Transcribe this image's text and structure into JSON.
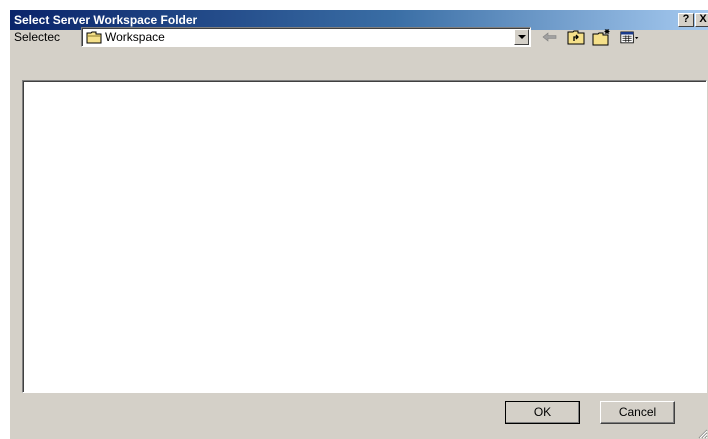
{
  "window": {
    "title": "Select Server Workspace Folder",
    "help_label": "?",
    "close_label": "X"
  },
  "location": {
    "label": "Selectec",
    "value": "Workspace",
    "icon": "folder-icon"
  },
  "toolbar": {
    "icons": [
      "back-arrow-icon",
      "up-folder-icon",
      "new-folder-icon",
      "view-menu-icon"
    ]
  },
  "buttons": {
    "ok_label": "OK",
    "cancel_label": "Cancel"
  },
  "colors": {
    "title_start": "#0a246a",
    "title_end": "#a6caf0",
    "face": "#d4d0c8"
  }
}
